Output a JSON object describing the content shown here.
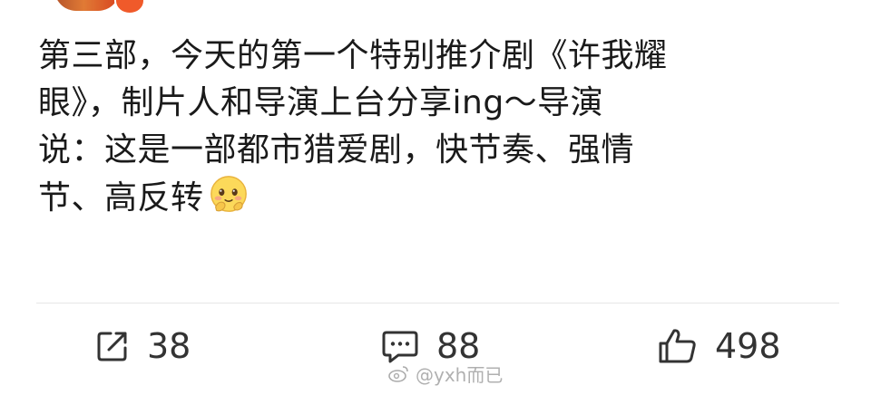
{
  "post": {
    "lines": [
      "第三部，今天的第一个特别推介剧《许我耀",
      "眼》，制片人和导演上台分享ing～导演",
      "说：这是一部都市猎爱剧，快节奏、强情",
      "节、高反转"
    ],
    "emoji": "shy-smile-emoji"
  },
  "actions": {
    "repost_count": "38",
    "comment_count": "88",
    "like_count": "498"
  },
  "icons": {
    "repost": "repost-icon",
    "comment": "comment-icon",
    "like": "like-icon"
  },
  "watermark": {
    "text": "@yxh而已"
  },
  "colors": {
    "text": "#1a1a1a",
    "icon": "#333333",
    "divider": "#e6e6e6"
  }
}
